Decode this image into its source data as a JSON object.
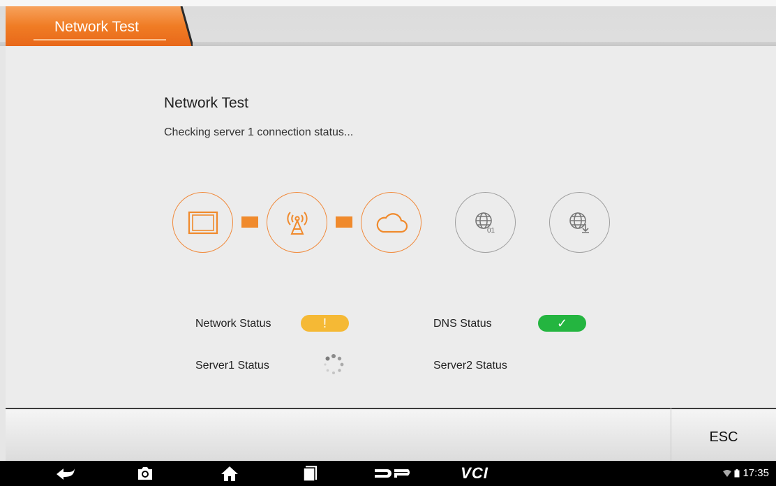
{
  "header": {
    "tab_label": "Network Test"
  },
  "main": {
    "title": "Network Test",
    "subtitle": "Checking server 1 connection status...",
    "icons": [
      "tablet-icon",
      "antenna-icon",
      "cloud-icon",
      "globe-01-icon",
      "globe-download-icon"
    ],
    "statuses": {
      "network": {
        "label": "Network Status",
        "state": "warning",
        "symbol": "!"
      },
      "dns": {
        "label": "DNS Status",
        "state": "ok",
        "symbol": "✓"
      },
      "server1": {
        "label": "Server1 Status",
        "state": "loading"
      },
      "server2": {
        "label": "Server2 Status",
        "state": "pending"
      }
    },
    "globe_badge": "01"
  },
  "footer": {
    "esc_label": "ESC"
  },
  "navbar": {
    "icons": [
      "back-icon",
      "camera-icon",
      "home-icon",
      "recent-apps-icon",
      "dp-logo-icon",
      "vci-icon"
    ],
    "vci_label": "VCI",
    "time": "17:35"
  },
  "colors": {
    "accent": "#f08a2c",
    "warning": "#f5b935",
    "ok": "#24b540",
    "inactive": "#a0a0a0"
  }
}
